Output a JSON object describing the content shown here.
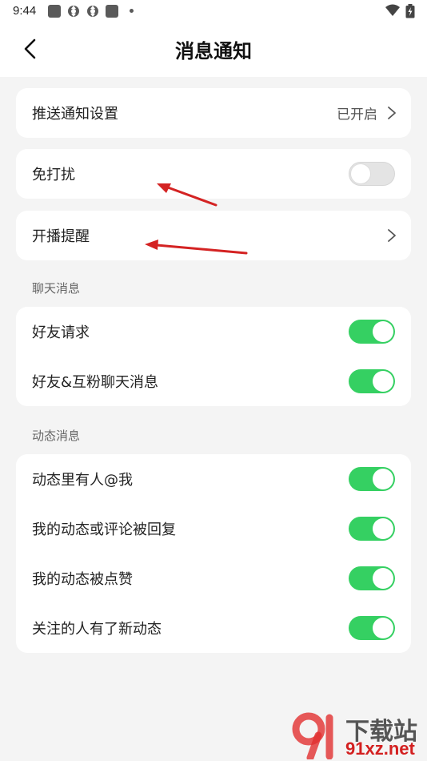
{
  "status_bar": {
    "time": "9:44",
    "icons": [
      "app-notification-icon",
      "sync-icon",
      "sync-icon",
      "app-notification-icon",
      "more-dot-icon",
      "wifi-icon",
      "battery-icon"
    ]
  },
  "header": {
    "title": "消息通知",
    "back_icon": "back-arrow-icon"
  },
  "settings": {
    "push": {
      "label": "推送通知设置",
      "value": "已开启"
    },
    "dnd": {
      "label": "免打扰",
      "enabled": false
    },
    "live_reminder": {
      "label": "开播提醒"
    }
  },
  "chat_section": {
    "title": "聊天消息",
    "items": [
      {
        "label": "好友请求",
        "enabled": true
      },
      {
        "label": "好友&互粉聊天消息",
        "enabled": true
      }
    ]
  },
  "activity_section": {
    "title": "动态消息",
    "items": [
      {
        "label": "动态里有人@我",
        "enabled": true
      },
      {
        "label": "我的动态或评论被回复",
        "enabled": true
      },
      {
        "label": "我的动态被点赞",
        "enabled": true
      },
      {
        "label": "关注的人有了新动态",
        "enabled": true
      }
    ]
  },
  "colors": {
    "toggle_on": "#35d062",
    "toggle_off": "#e4e4e4",
    "annotation_arrow": "#d42323"
  },
  "watermark": {
    "brand": "下载站",
    "domain": "91xz.net"
  }
}
